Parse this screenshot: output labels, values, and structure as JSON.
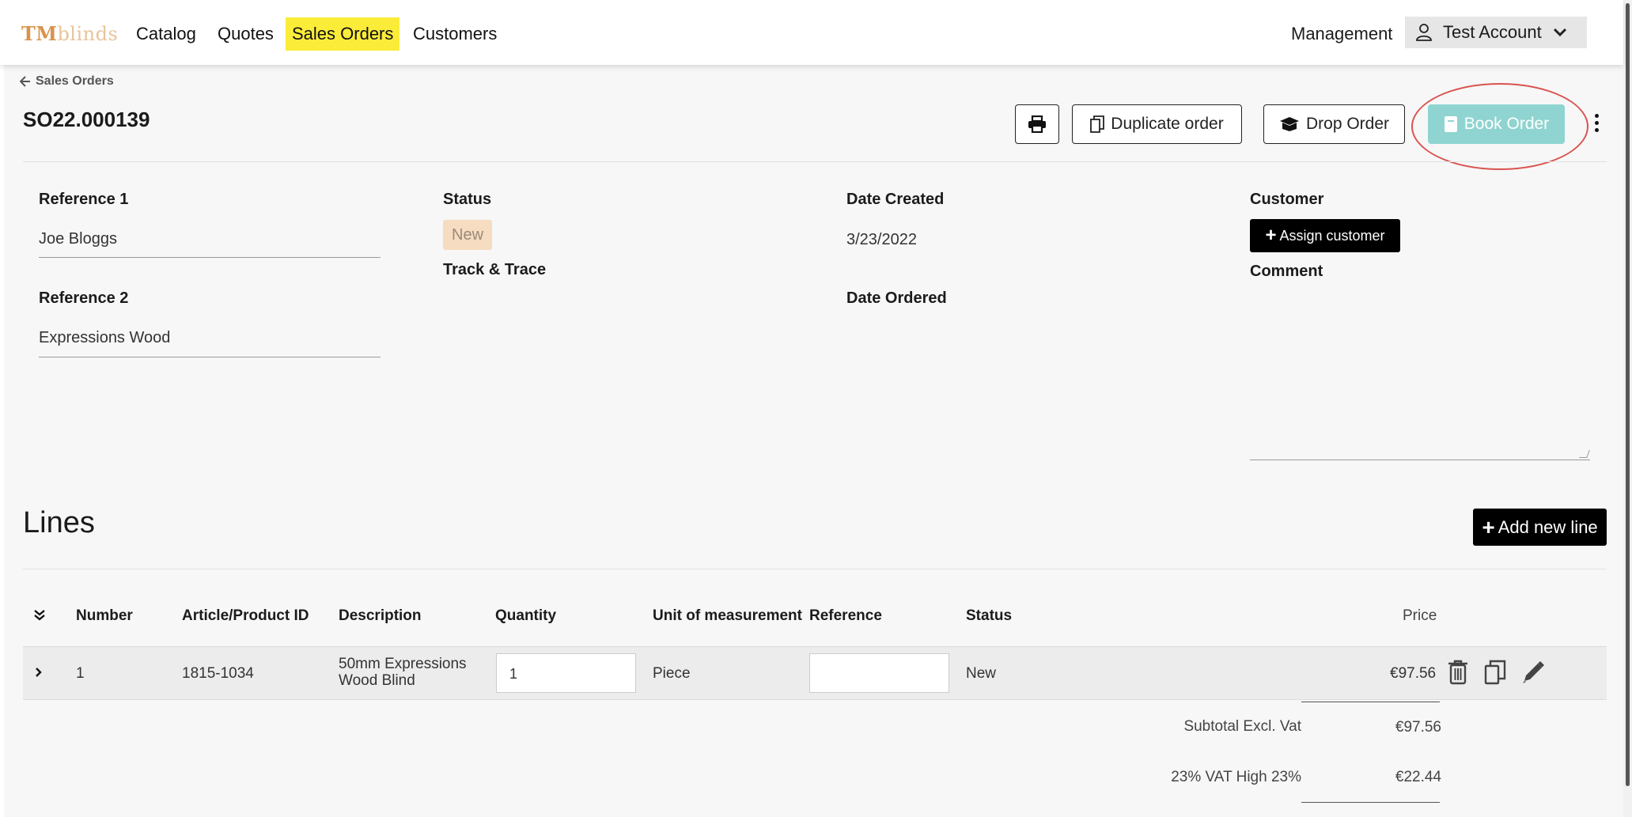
{
  "nav": {
    "logo_tm": "TM",
    "logo_rest": "blinds",
    "links": [
      "Catalog",
      "Quotes",
      "Sales Orders",
      "Customers"
    ],
    "management": "Management",
    "account": "Test Account"
  },
  "header": {
    "back_label": "Sales Orders",
    "order_id": "SO22.000139",
    "duplicate_label": "Duplicate order",
    "drop_label": "Drop Order",
    "book_label": "Book Order"
  },
  "fields": {
    "reference1_label": "Reference 1",
    "reference1_value": "Joe Bloggs",
    "reference2_label": "Reference 2",
    "reference2_value": "Expressions Wood",
    "status_label": "Status",
    "status_value": "New",
    "track_label": "Track & Trace",
    "date_created_label": "Date Created",
    "date_created_value": "3/23/2022",
    "date_ordered_label": "Date Ordered",
    "customer_label": "Customer",
    "assign_label": "Assign customer",
    "comment_label": "Comment"
  },
  "lines": {
    "title": "Lines",
    "add_label": "Add new line",
    "columns": [
      "Number",
      "Article/Product ID",
      "Description",
      "Quantity",
      "Unit of measurement",
      "Reference",
      "Status",
      "Price"
    ],
    "rows": [
      {
        "number": "1",
        "article": "1815-1034",
        "description_1": "50mm Expressions",
        "description_2": "Wood Blind",
        "quantity": "1",
        "unit": "Piece",
        "reference": "",
        "status": "New",
        "price": "€97.56"
      }
    ],
    "subtotal_label": "Subtotal Excl. Vat",
    "subtotal_value": "€97.56",
    "vat_label": "23% VAT High 23%",
    "vat_value": "€22.44"
  },
  "colors": {
    "accent_highlight": "#fbec3a",
    "book_button": "#8fd4d0",
    "status_badge": "#f6dcc0",
    "annotation_ring": "#d9534f"
  }
}
